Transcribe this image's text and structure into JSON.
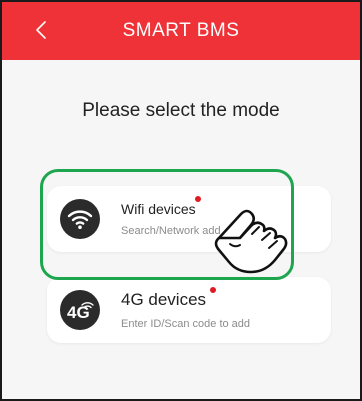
{
  "header": {
    "back_label": "<",
    "title": "SMART BMS"
  },
  "prompt": "Please select the mode",
  "modes": [
    {
      "icon": "wifi-icon",
      "title": "Wifi devices",
      "subtitle": "Search/Network add"
    },
    {
      "icon": "4g-icon",
      "badge": "4G",
      "title": "4G devices",
      "subtitle": "Enter ID/Scan code to add"
    }
  ],
  "colors": {
    "header": "#ee3237",
    "highlight": "#1ea64f",
    "dot": "#e01b24",
    "icon_bg": "#2b2b2b"
  }
}
